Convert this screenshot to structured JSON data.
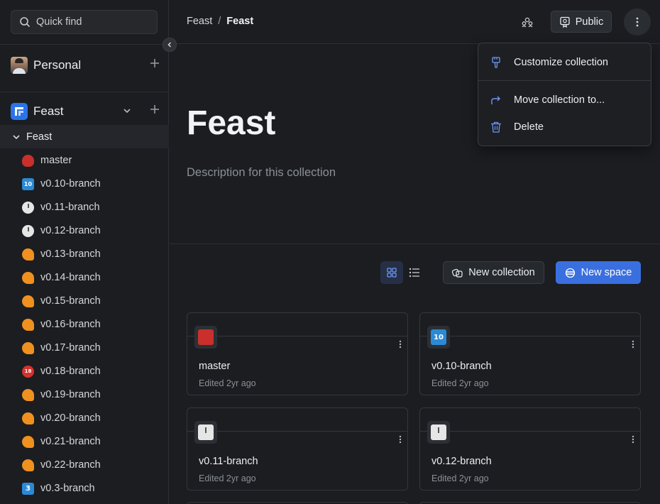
{
  "sidebar": {
    "search_label": "Quick find",
    "personal_label": "Personal",
    "org_label": "Feast",
    "tree_root_label": "Feast",
    "items": [
      {
        "label": "master",
        "icon": "ogre"
      },
      {
        "label": "v0.10-branch",
        "icon": "ten"
      },
      {
        "label": "v0.11-branch",
        "icon": "clock"
      },
      {
        "label": "v0.12-branch",
        "icon": "clock"
      },
      {
        "label": "v0.13-branch",
        "icon": "croissant"
      },
      {
        "label": "v0.14-branch",
        "icon": "croissant"
      },
      {
        "label": "v0.15-branch",
        "icon": "croissant"
      },
      {
        "label": "v0.16-branch",
        "icon": "croissant"
      },
      {
        "label": "v0.17-branch",
        "icon": "croissant"
      },
      {
        "label": "v0.18-branch",
        "icon": "noentry"
      },
      {
        "label": "v0.19-branch",
        "icon": "croissant"
      },
      {
        "label": "v0.20-branch",
        "icon": "croissant"
      },
      {
        "label": "v0.21-branch",
        "icon": "croissant"
      },
      {
        "label": "v0.22-branch",
        "icon": "croissant"
      },
      {
        "label": "v0.3-branch",
        "icon": "three"
      }
    ]
  },
  "header": {
    "breadcrumb_parent": "Feast",
    "breadcrumb_sep": "/",
    "breadcrumb_current": "Feast",
    "public_label": "Public"
  },
  "hero": {
    "title": "Feast",
    "description": "Description for this collection"
  },
  "toolbar": {
    "new_collection_label": "New collection",
    "new_space_label": "New space"
  },
  "cards": [
    {
      "name": "master",
      "edited": "Edited 2yr ago",
      "icon": "ogre"
    },
    {
      "name": "v0.10-branch",
      "edited": "Edited 2yr ago",
      "icon": "ten"
    },
    {
      "name": "v0.11-branch",
      "edited": "Edited 2yr ago",
      "icon": "clock"
    },
    {
      "name": "v0.12-branch",
      "edited": "Edited 2yr ago",
      "icon": "clock"
    }
  ],
  "menu": {
    "customize_label": "Customize collection",
    "move_label": "Move collection to...",
    "delete_label": "Delete"
  },
  "emoji_text": {
    "ten": "10",
    "three": "3",
    "noentry": "18"
  },
  "colors": {
    "accent": "#3a6fe0",
    "background": "#1b1d21"
  }
}
